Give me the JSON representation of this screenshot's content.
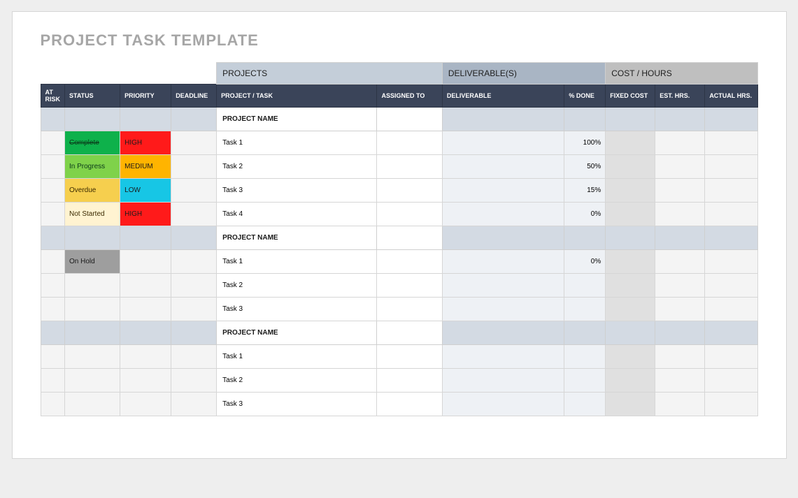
{
  "title": "PROJECT TASK TEMPLATE",
  "groupHeaders": {
    "projects": "PROJECTS",
    "deliverables": "DELIVERABLE(S)",
    "cost": "COST / HOURS"
  },
  "columns": {
    "atRisk": "AT RISK",
    "status": "STATUS",
    "priority": "PRIORITY",
    "deadline": "DEADLINE",
    "task": "PROJECT / TASK",
    "assigned": "ASSIGNED TO",
    "deliverable": "DELIVERABLE",
    "done": "% DONE",
    "fixed": "FIXED COST",
    "est": "EST. HRS.",
    "actual": "ACTUAL HRS."
  },
  "sections": [
    {
      "name": "PROJECT NAME",
      "tasks": [
        {
          "status": "Complete",
          "priority": "HIGH",
          "task": "Task 1",
          "done": "100%"
        },
        {
          "status": "In Progress",
          "priority": "MEDIUM",
          "task": "Task 2",
          "done": "50%"
        },
        {
          "status": "Overdue",
          "priority": "LOW",
          "task": "Task 3",
          "done": "15%"
        },
        {
          "status": "Not Started",
          "priority": "HIGH",
          "task": "Task 4",
          "done": "0%"
        }
      ]
    },
    {
      "name": "PROJECT NAME",
      "tasks": [
        {
          "status": "On Hold",
          "priority": "",
          "task": "Task 1",
          "done": "0%"
        },
        {
          "status": "",
          "priority": "",
          "task": "Task 2",
          "done": ""
        },
        {
          "status": "",
          "priority": "",
          "task": "Task 3",
          "done": ""
        }
      ]
    },
    {
      "name": "PROJECT NAME",
      "tasks": [
        {
          "status": "",
          "priority": "",
          "task": "Task 1",
          "done": ""
        },
        {
          "status": "",
          "priority": "",
          "task": "Task 2",
          "done": ""
        },
        {
          "status": "",
          "priority": "",
          "task": "Task 3",
          "done": ""
        }
      ]
    }
  ]
}
